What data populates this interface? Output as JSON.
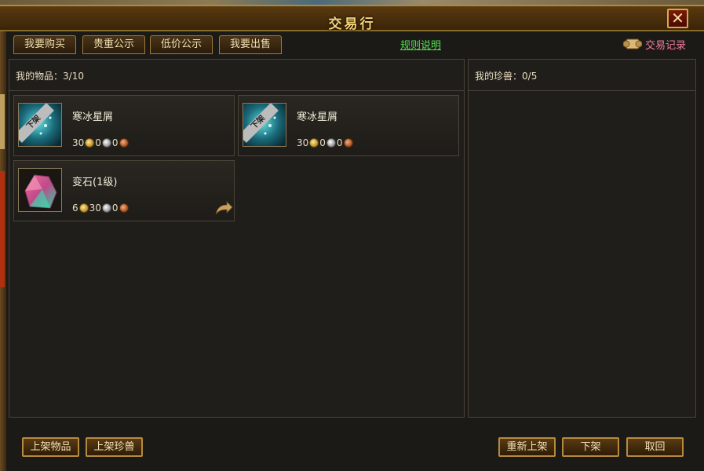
{
  "window": {
    "title": "交易行"
  },
  "tabs": [
    "我要购买",
    "贵重公示",
    "低价公示",
    "我要出售"
  ],
  "rules_link": "规则说明",
  "trade_record": "交易记录",
  "items_panel": {
    "label": "我的物品：",
    "count": "3/10",
    "items": [
      {
        "name": "寒冰星屑",
        "badge": "下架",
        "price": {
          "gold": "30",
          "silver": "0",
          "copper": "0"
        },
        "icon": "ice-star-shard"
      },
      {
        "name": "寒冰星屑",
        "badge": "下架",
        "price": {
          "gold": "30",
          "silver": "0",
          "copper": "0"
        },
        "icon": "ice-star-shard"
      },
      {
        "name": "变石(1级)",
        "badge": "",
        "price": {
          "gold": "6",
          "silver": "30",
          "copper": "0"
        },
        "icon": "gem-crystal"
      }
    ]
  },
  "pets_panel": {
    "label": "我的珍兽：",
    "count": "0/5"
  },
  "footer": {
    "list_item": "上架物品",
    "list_pet": "上架珍兽",
    "relist": "重新上架",
    "delist": "下架",
    "cancel": "取回"
  },
  "colors": {
    "accent_gold": "#b68a3e",
    "link_green": "#4fe04f",
    "record_pink": "#f07aa0"
  }
}
